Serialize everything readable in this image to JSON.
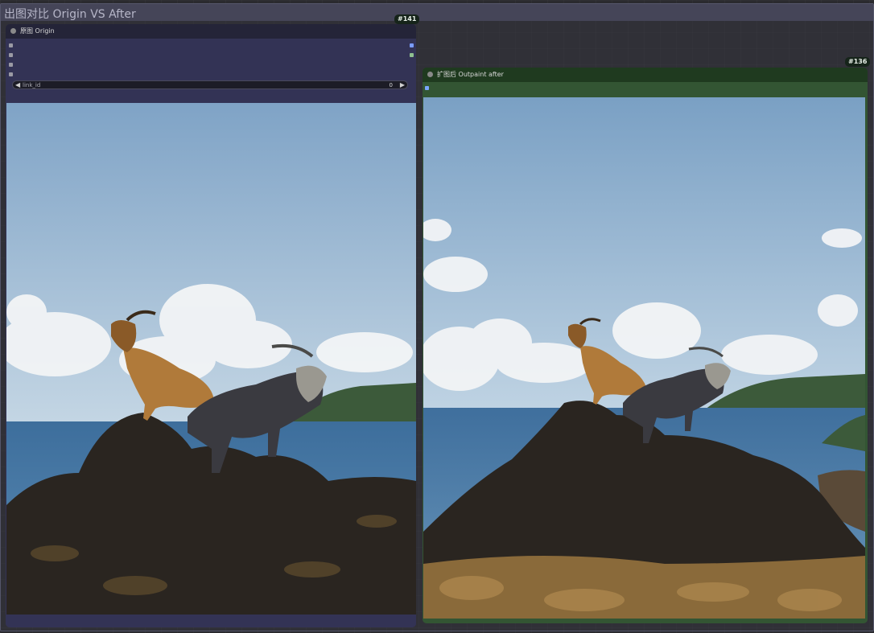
{
  "group": {
    "title": "出图对比 Origin VS After"
  },
  "node_origin": {
    "id": "#141",
    "title": "原图 Origin",
    "widget": {
      "label": "link_id",
      "value": "0"
    },
    "image_alt": "Two goats standing on a dark volcanic rock by the sea under a blue sky"
  },
  "node_after": {
    "id": "#136",
    "title": "扩图后 Outpaint after",
    "image_alt": "Outpainted wider view of two goats on a rocky outcrop by the sea"
  },
  "colors": {
    "origin_header": "#242438",
    "origin_body": "#333355",
    "after_header": "#1f3a1f",
    "after_body": "#335533",
    "badge": "#16241a",
    "sky_top": "#7da0c4",
    "sky_bottom": "#b9cfe0",
    "sea": "#4b7ba6",
    "rock": "#2a2520"
  }
}
